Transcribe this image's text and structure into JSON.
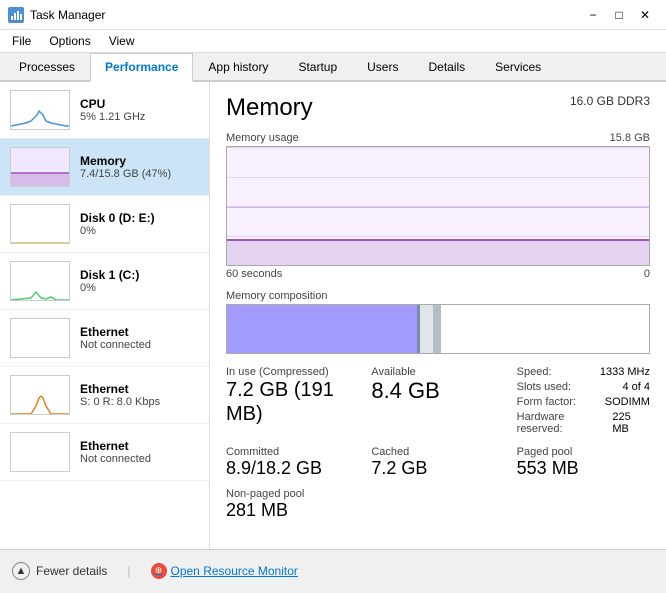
{
  "titleBar": {
    "icon": "📊",
    "title": "Task Manager",
    "minimize": "−",
    "maximize": "□",
    "close": "✕"
  },
  "menuBar": {
    "items": [
      "File",
      "Options",
      "View"
    ]
  },
  "tabs": [
    {
      "label": "Processes",
      "active": false
    },
    {
      "label": "Performance",
      "active": true
    },
    {
      "label": "App history",
      "active": false
    },
    {
      "label": "Startup",
      "active": false
    },
    {
      "label": "Users",
      "active": false
    },
    {
      "label": "Details",
      "active": false
    },
    {
      "label": "Services",
      "active": false
    }
  ],
  "sidebar": {
    "items": [
      {
        "id": "cpu",
        "title": "CPU",
        "sub": "5% 1.21 GHz",
        "selected": false
      },
      {
        "id": "memory",
        "title": "Memory",
        "sub": "7.4/15.8 GB (47%)",
        "selected": true
      },
      {
        "id": "disk0",
        "title": "Disk 0 (D: E:)",
        "sub": "0%",
        "selected": false
      },
      {
        "id": "disk1",
        "title": "Disk 1 (C:)",
        "sub": "0%",
        "selected": false
      },
      {
        "id": "ethernet1",
        "title": "Ethernet",
        "sub": "Not connected",
        "selected": false
      },
      {
        "id": "ethernet2",
        "title": "Ethernet",
        "sub": "S: 0 R: 8.0 Kbps",
        "selected": false
      },
      {
        "id": "ethernet3",
        "title": "Ethernet",
        "sub": "Not connected",
        "selected": false
      }
    ]
  },
  "detail": {
    "title": "Memory",
    "spec": "16.0 GB DDR3",
    "chart": {
      "label": "Memory usage",
      "maxLabel": "15.8 GB",
      "timeStart": "60 seconds",
      "timeEnd": "0"
    },
    "composition": {
      "label": "Memory composition"
    },
    "stats": {
      "inUse": {
        "label": "In use (Compressed)",
        "value": "7.2 GB (191 MB)"
      },
      "available": {
        "label": "Available",
        "value": "8.4 GB"
      },
      "committed": {
        "label": "Committed",
        "value": "8.9/18.2 GB"
      },
      "cached": {
        "label": "Cached",
        "value": "7.2 GB"
      },
      "pagedPool": {
        "label": "Paged pool",
        "value": "553 MB"
      },
      "nonPagedPool": {
        "label": "Non-paged pool",
        "value": "281 MB"
      }
    },
    "rightStats": {
      "speed": {
        "label": "Speed:",
        "value": "1333 MHz"
      },
      "slots": {
        "label": "Slots used:",
        "value": "4 of 4"
      },
      "form": {
        "label": "Form factor:",
        "value": "SODIMM"
      },
      "hw": {
        "label": "Hardware reserved:",
        "value": "225 MB"
      }
    }
  },
  "bottomBar": {
    "fewerDetails": "Fewer details",
    "openRM": "Open Resource Monitor"
  }
}
